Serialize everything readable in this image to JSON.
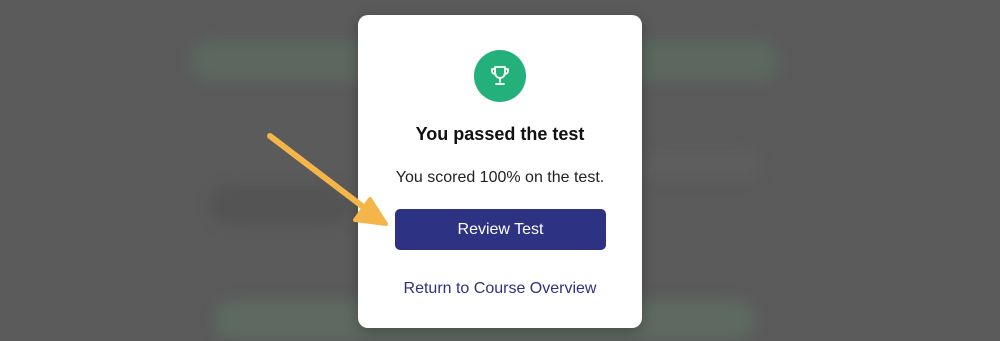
{
  "modal": {
    "icon": "trophy-icon",
    "title": "You passed the test",
    "message": "You scored 100% on the test.",
    "primary_button_label": "Review Test",
    "secondary_link_label": "Return to Course Overview"
  },
  "annotation": {
    "icon": "arrow-icon",
    "color": "#f4b54a"
  },
  "colors": {
    "success_badge": "#24b07a",
    "primary": "#2e3283",
    "overlay": "#5b5b5b"
  }
}
